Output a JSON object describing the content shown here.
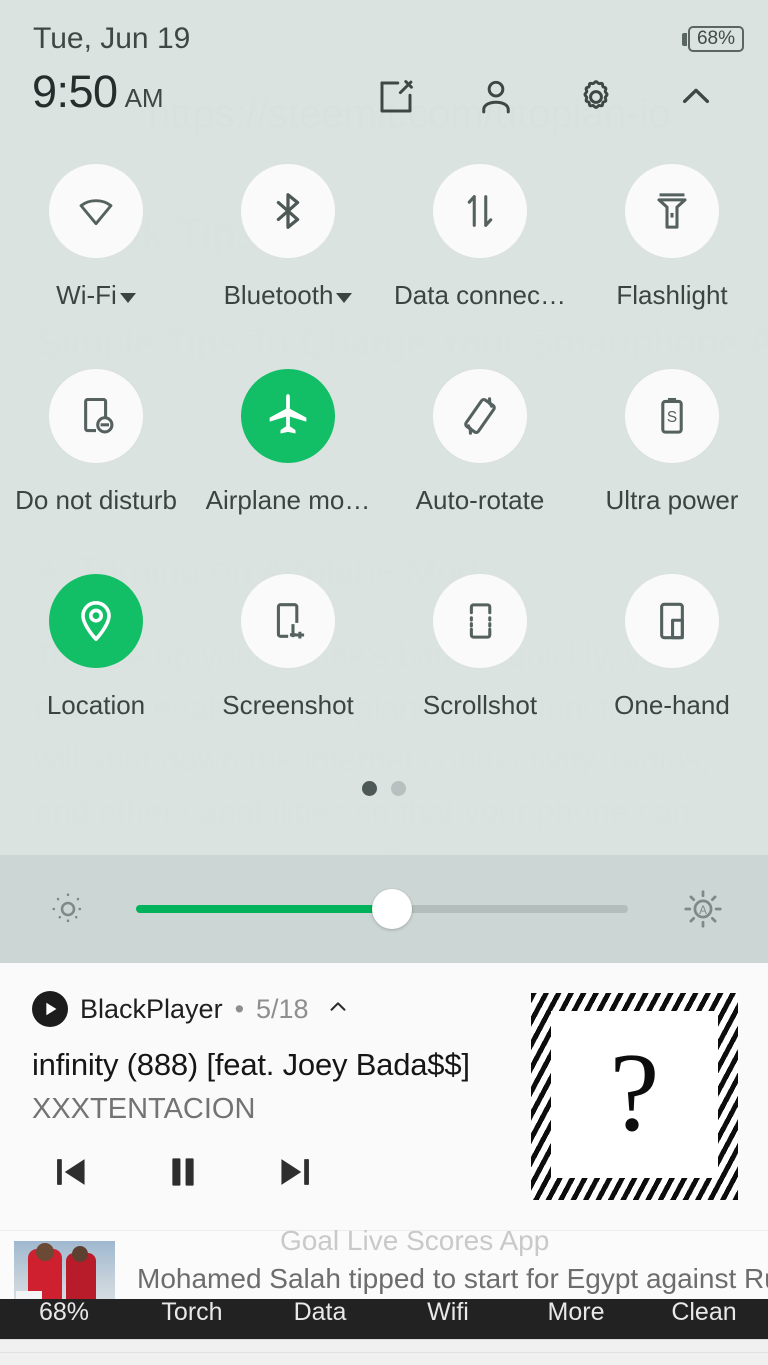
{
  "background_article": {
    "url_watermark": "https://steemit.com/utopian-io",
    "heading": "Geek Tips",
    "title": "Simple Tips To Charge Your Smartphone As Fast",
    "subtitle": "4. Turning on Airplane Mode",
    "paragraph": "To juice up your phone's battery quickly, you need to enable the Airplane mode function. This will shut down the internet connectivity, radios, and other capabilities so that your phone can focus only on charging. Remember"
  },
  "status": {
    "date": "Tue, Jun 19",
    "time": "9:50",
    "meridiem": "AM",
    "battery_percent": "68%"
  },
  "header_actions": [
    {
      "name": "edit-icon",
      "label": "Edit"
    },
    {
      "name": "user-icon",
      "label": "User"
    },
    {
      "name": "settings-icon",
      "label": "Settings"
    },
    {
      "name": "collapse-icon",
      "label": "Collapse"
    }
  ],
  "quick_settings": {
    "rows": [
      [
        {
          "label": "Wi-Fi",
          "icon": "wifi-icon",
          "active": false,
          "has_caret": true
        },
        {
          "label": "Bluetooth",
          "icon": "bluetooth-icon",
          "active": false,
          "has_caret": true
        },
        {
          "label": "Data connec…",
          "icon": "data-connection-icon",
          "active": false,
          "has_caret": false
        },
        {
          "label": "Flashlight",
          "icon": "flashlight-icon",
          "active": false,
          "has_caret": false
        }
      ],
      [
        {
          "label": "Do not disturb",
          "icon": "do-not-disturb-icon",
          "active": false,
          "has_caret": false
        },
        {
          "label": "Airplane mo…",
          "icon": "airplane-icon",
          "active": true,
          "has_caret": false
        },
        {
          "label": "Auto-rotate",
          "icon": "auto-rotate-icon",
          "active": false,
          "has_caret": false
        },
        {
          "label": "Ultra power",
          "icon": "ultra-power-icon",
          "active": false,
          "has_caret": false
        }
      ],
      [
        {
          "label": "Location",
          "icon": "location-icon",
          "active": true,
          "has_caret": false
        },
        {
          "label": "Screenshot",
          "icon": "screenshot-icon",
          "active": false,
          "has_caret": false
        },
        {
          "label": "Scrollshot",
          "icon": "scrollshot-icon",
          "active": false,
          "has_caret": false
        },
        {
          "label": "One-hand",
          "icon": "one-hand-icon",
          "active": false,
          "has_caret": false
        }
      ]
    ],
    "pages": 2,
    "active_page": 1
  },
  "brightness": {
    "value_percent": 52,
    "left_icon": "brightness-low-icon",
    "right_icon": "brightness-auto-icon",
    "accent_color": "#00b259"
  },
  "notifications": {
    "media": {
      "app_name": "BlackPlayer",
      "separator": "•",
      "count": "5/18",
      "expand_icon": "chevron-up-icon",
      "track_title": "infinity (888) [feat. Joey Bada$$]",
      "artist": "XXXTENTACION",
      "album_art_symbol": "?",
      "controls": [
        {
          "name": "previous-button",
          "icon": "skip-previous-icon"
        },
        {
          "name": "pause-button",
          "icon": "pause-icon"
        },
        {
          "name": "next-button",
          "icon": "skip-next-icon"
        }
      ]
    },
    "news": {
      "hidden_title": "Goal Live Scores App",
      "headline": "Mohamed Salah tipped to start for Egypt against Ru…"
    }
  },
  "widget_bar": {
    "items": [
      "68%",
      "Torch",
      "Data",
      "Wifi",
      "More",
      "Clean"
    ]
  },
  "colors": {
    "panel_bg": "#dbe3e1",
    "tile_bg": "#fafafa",
    "active_green": "#12be66",
    "brightness_bg": "#ccd6d4",
    "notification_bg": "#fafafa"
  }
}
